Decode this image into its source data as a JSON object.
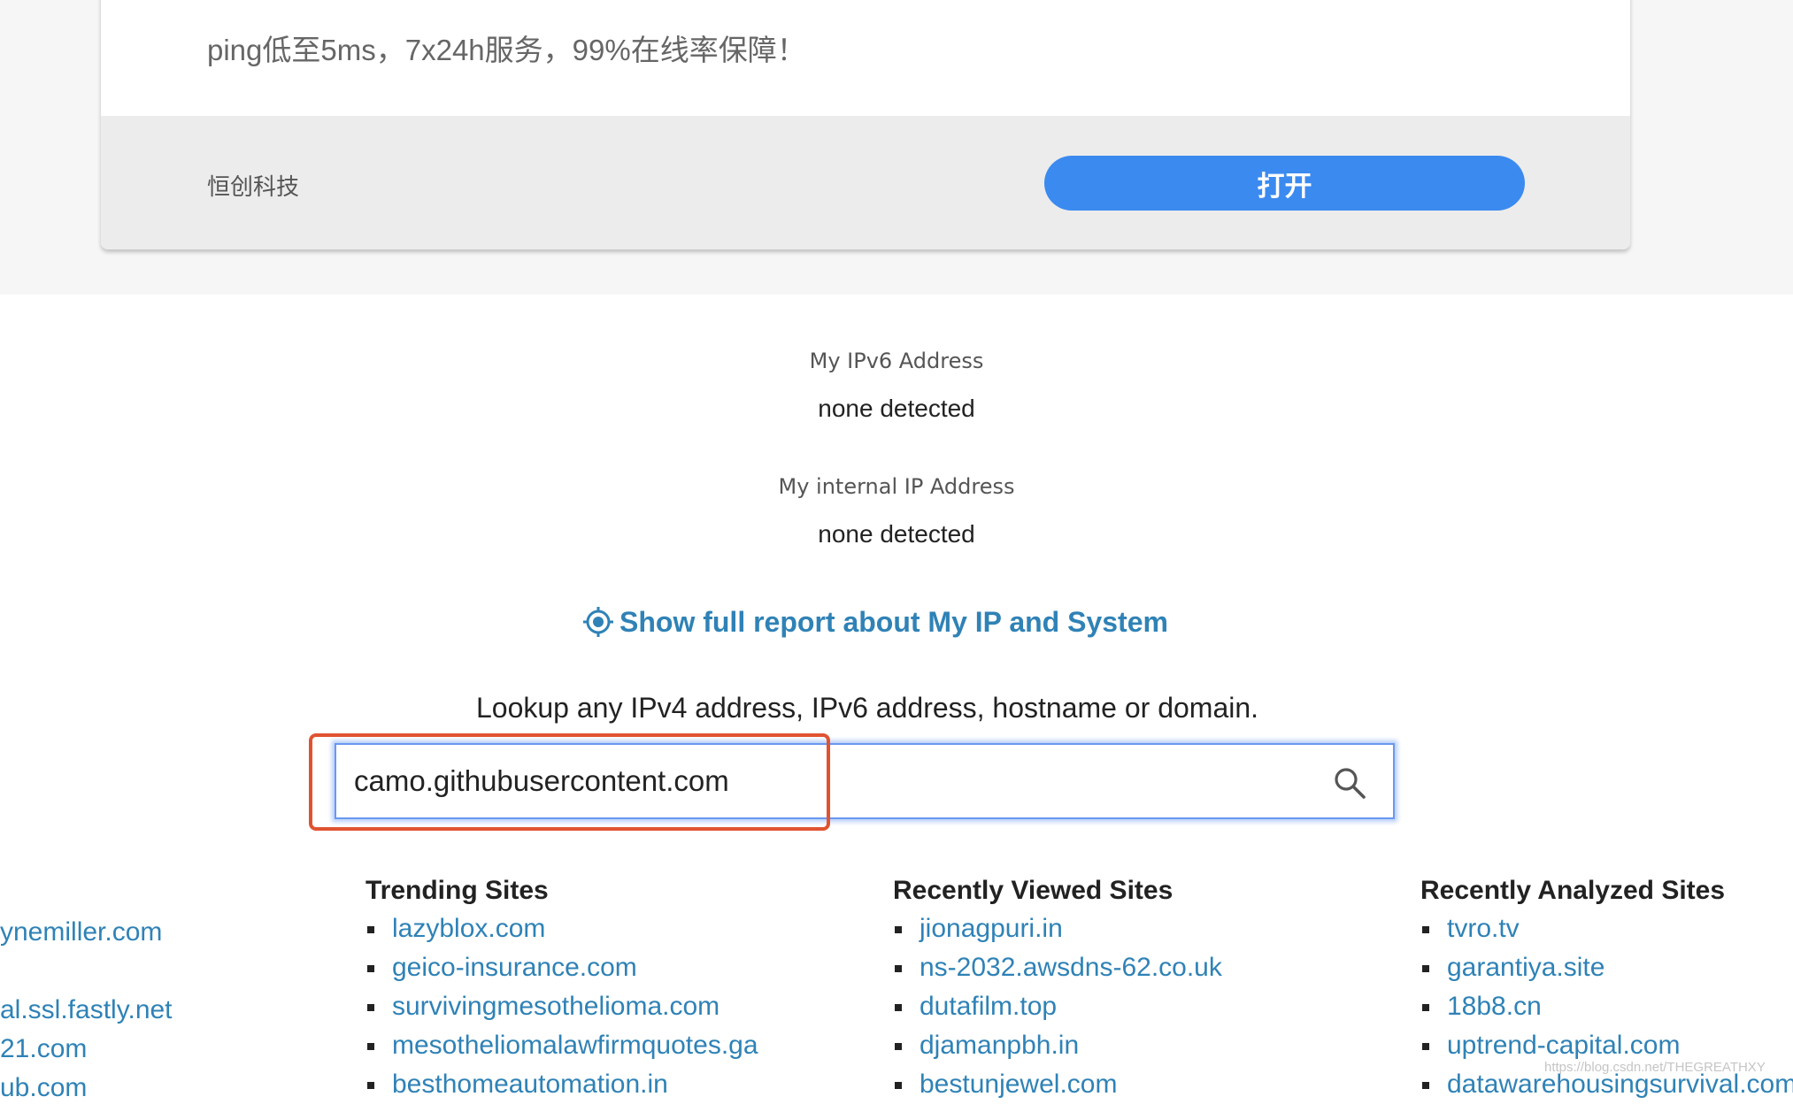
{
  "ad": {
    "description": "ping低至5ms，7x24h服务，99%在线率保障！",
    "brand": "恒创科技",
    "open_button": "打开"
  },
  "ipv6": {
    "label": "My IPv6 Address",
    "value": "none detected"
  },
  "internal_ip": {
    "label": "My internal IP Address",
    "value": "none detected"
  },
  "report_link": {
    "label": "Show full report about My IP and System",
    "icon": "crosshair-icon"
  },
  "lookup": {
    "prompt": "Lookup any IPv4 address, IPv6 address, hostname or domain.",
    "value": "camo.githubusercontent.com",
    "search_icon": "magnifier-icon",
    "highlight_color": "#e05331"
  },
  "columns": {
    "partial": {
      "items": [
        "ynemiller.com",
        "",
        "al.ssl.fastly.net",
        "21.com",
        "ub.com"
      ]
    },
    "trending": {
      "title": "Trending Sites",
      "items": [
        "lazyblox.com",
        "geico-insurance.com",
        "survivingmesothelioma.com",
        "mesotheliomalawfirmquotes.ga",
        "besthomeautomation.in"
      ]
    },
    "recently_viewed": {
      "title": "Recently Viewed Sites",
      "items": [
        "jionagpuri.in",
        "ns-2032.awsdns-62.co.uk",
        "dutafilm.top",
        "djamanpbh.in",
        "bestunjewel.com"
      ]
    },
    "recently_analyzed": {
      "title": "Recently Analyzed Sites",
      "items": [
        "tvro.tv",
        "garantiya.site",
        "18b8.cn",
        "uptrend-capital.com",
        "datawarehousingsurvival.com"
      ]
    }
  },
  "watermark": "https://blog.csdn.net/THEGREATHXY",
  "colors": {
    "link": "#2f82b6",
    "button": "#3b8af0",
    "focus_ring": "#6a98f0"
  }
}
